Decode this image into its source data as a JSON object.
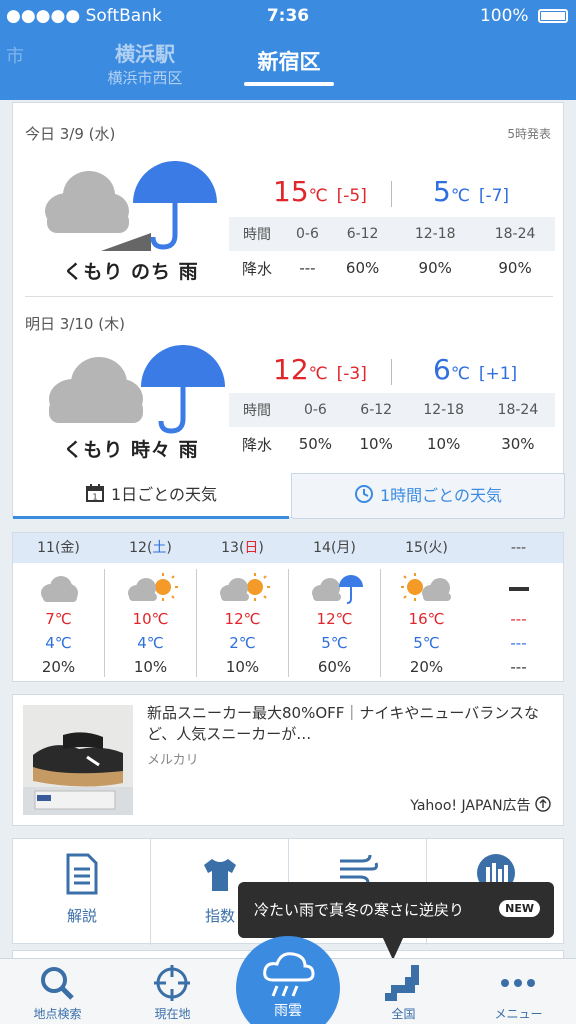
{
  "status_bar": {
    "carrier": "●●●●● SoftBank",
    "time": "7:36",
    "battery": "100%"
  },
  "locations": {
    "prev_partial": "市",
    "other_name": "横浜駅",
    "other_sub": "横浜市西区",
    "current": "新宿区"
  },
  "forecast": {
    "issued": "5時発表",
    "rain_header": [
      "時間",
      "0-6",
      "6-12",
      "12-18",
      "18-24"
    ],
    "rain_label": "降水",
    "today": {
      "date": "今日 3/9 (水)",
      "weather": "くもり のち 雨",
      "icon": "cloud-then-rain-icon",
      "high": "15",
      "high_diff": "[-5]",
      "low": "5",
      "low_diff": "[-7]",
      "unit": "℃",
      "rain": [
        "---",
        "60%",
        "90%",
        "90%"
      ]
    },
    "tomorrow": {
      "date": "明日 3/10 (木)",
      "weather": "くもり 時々 雨",
      "icon": "cloud-sometimes-rain-icon",
      "high": "12",
      "high_diff": "[-3]",
      "low": "6",
      "low_diff": "[+1]",
      "unit": "℃",
      "rain": [
        "50%",
        "10%",
        "10%",
        "30%"
      ]
    },
    "tabs": {
      "daily": "1日ごとの天気",
      "hourly": "1時間ごとの天気"
    }
  },
  "weekly": [
    {
      "day": "11(金)",
      "icon": "cloud-icon",
      "high": "7℃",
      "low": "4℃",
      "rain": "20%"
    },
    {
      "day": "12(土)",
      "icon": "cloud-sun-icon",
      "high": "10℃",
      "low": "4℃",
      "rain": "10%"
    },
    {
      "day": "13(日)",
      "icon": "cloud-sun-icon",
      "high": "12℃",
      "low": "2℃",
      "rain": "10%"
    },
    {
      "day": "14(月)",
      "icon": "cloud-umbrella-icon",
      "high": "12℃",
      "low": "5℃",
      "rain": "60%"
    },
    {
      "day": "15(火)",
      "icon": "sun-cloud-icon",
      "high": "16℃",
      "low": "5℃",
      "rain": "20%"
    },
    {
      "day": "---",
      "icon": "dash-icon",
      "high": "---",
      "low": "---",
      "rain": "---"
    }
  ],
  "ad": {
    "title": "新品スニーカー最大80%OFF｜ナイキやニューバランスなど、人気スニーカーが…",
    "source": "メルカリ",
    "sponsor": "Yahoo! JAPAN広告"
  },
  "tools": [
    "解説",
    "指数",
    "",
    ""
  ],
  "tooltip": {
    "message": "冷たい雨で真冬の寒さに逆戻り",
    "badge": "NEW"
  },
  "nav": {
    "search": "地点検索",
    "current_location": "現在地",
    "rain_cloud": "雨雲",
    "nationwide": "全国",
    "menu": "メニュー"
  },
  "colors": {
    "accent": "#3b8be0",
    "high_temp": "#e0262b",
    "low_temp": "#2f6fde"
  }
}
